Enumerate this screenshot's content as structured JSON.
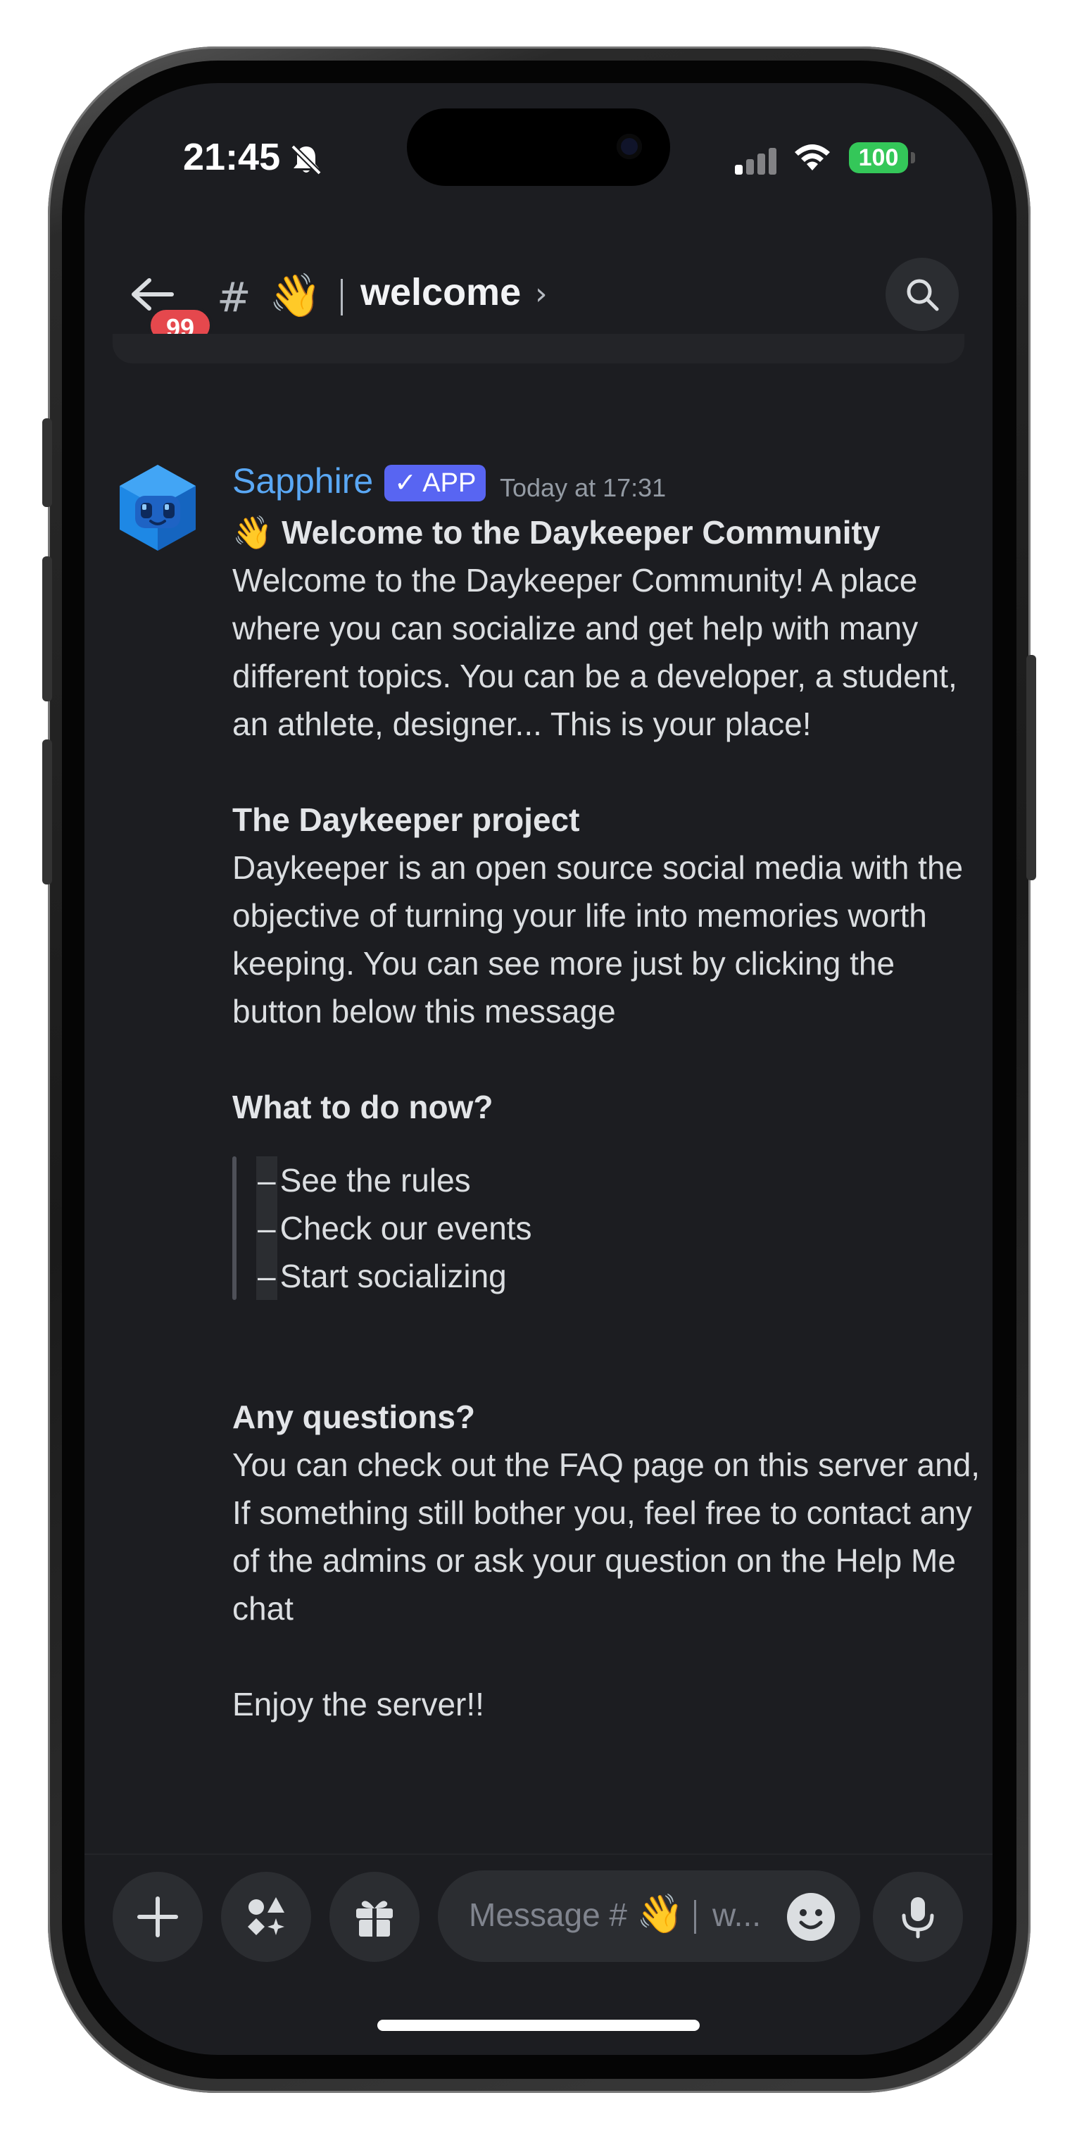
{
  "status_bar": {
    "time": "21:45",
    "battery": "100",
    "icons": [
      "bell-slash-icon",
      "signal-icon",
      "wifi-icon",
      "battery-icon"
    ]
  },
  "header": {
    "unread_badge": "99",
    "hash": "#",
    "channel_emoji": "👋",
    "channel_name": "welcome",
    "chevron": "›"
  },
  "message": {
    "author": "Sapphire",
    "app_tag": "✓ APP",
    "timestamp": "Today at 17:31",
    "title_emoji": "👋",
    "title": "Welcome to the Daykeeper Community",
    "intro": "Welcome to the Daykeeper Community! A place where you can socialize and get help with many different topics. You can be a developer, a student, an athlete, designer...  This is your place!",
    "project_heading": "The Daykeeper project",
    "project_text": "Daykeeper is an open source social media with the objective of turning your life into memories worth keeping. You can see more just by clicking the button below this message",
    "todo_heading": "What to do now?",
    "todo_items": [
      "See the rules",
      "Check our events",
      "Start socializing"
    ],
    "questions_heading": "Any questions?",
    "questions_text": "You can check out the FAQ page on this server and, If something still bother you, feel free to contact any of the admins or ask your question on the Help Me chat",
    "closing": "Enjoy the server!!"
  },
  "composer": {
    "placeholder": "Message #",
    "placeholder_emoji": "👋",
    "placeholder_tail": "w..."
  },
  "colors": {
    "background": "#1c1d21",
    "author": "#5aa8f5",
    "app_tag": "#5865f2",
    "badge": "#e5484d",
    "battery": "#34c759"
  }
}
